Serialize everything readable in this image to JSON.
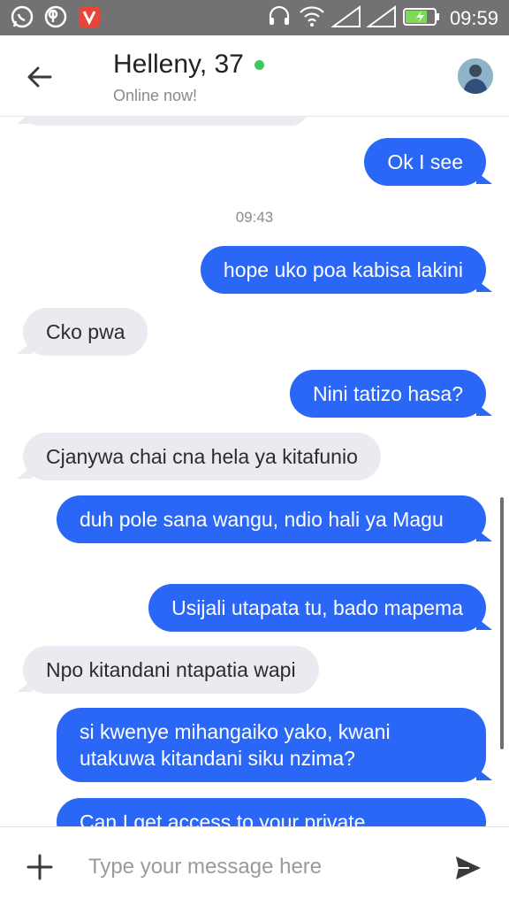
{
  "status_bar": {
    "time": "09:59",
    "left_icons": [
      "whatsapp-icon",
      "b-app-icon",
      "vidmate-icon"
    ],
    "right_icons": [
      "headset-icon",
      "wifi-icon",
      "signal-icon",
      "signal-icon",
      "battery-charging-icon"
    ]
  },
  "header": {
    "title": "Helleny, 37",
    "subtitle": "Online now!",
    "online_color": "#3ec95a"
  },
  "chat": {
    "timestamp": "09:43",
    "messages": [
      {
        "direction": "out",
        "text": "Ok I see"
      },
      {
        "direction": "out",
        "text": "hope uko poa kabisa lakini"
      },
      {
        "direction": "in",
        "text": "Cko pwa"
      },
      {
        "direction": "out",
        "text": "Nini tatizo hasa?"
      },
      {
        "direction": "in",
        "text": "Cjanywa chai  cna hela ya kitafunio"
      },
      {
        "direction": "out",
        "text": "duh pole sana wangu, ndio hali ya Magu"
      },
      {
        "direction": "out",
        "text": "Usijali utapata tu, bado mapema"
      },
      {
        "direction": "in",
        "text": "Npo kitandani ntapatia wapi"
      },
      {
        "direction": "out",
        "text": "si kwenye mihangaiko yako, kwani utakuwa kitandani siku nzima?"
      },
      {
        "direction": "out",
        "text": "Can I get access to your private"
      }
    ]
  },
  "composer": {
    "placeholder": "Type your message here"
  },
  "colors": {
    "outgoing_bubble": "#2b67f6",
    "incoming_bubble": "#e9ebf1",
    "status_bar": "#727272"
  }
}
